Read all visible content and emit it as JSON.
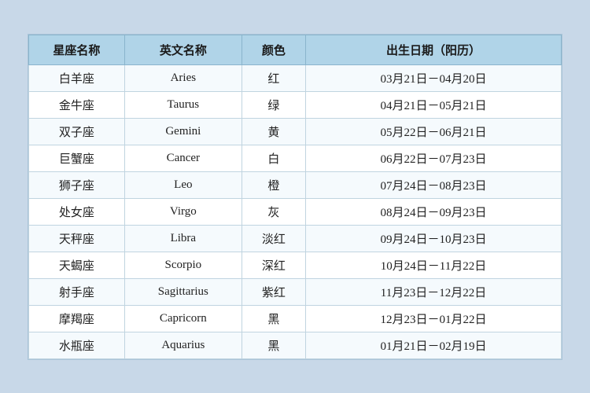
{
  "table": {
    "headers": [
      "星座名称",
      "英文名称",
      "颜色",
      "出生日期（阳历）"
    ],
    "rows": [
      {
        "name": "白羊座",
        "en": "Aries",
        "color": "红",
        "date": "03月21日－04月20日"
      },
      {
        "name": "金牛座",
        "en": "Taurus",
        "color": "绿",
        "date": "04月21日－05月21日"
      },
      {
        "name": "双子座",
        "en": "Gemini",
        "color": "黄",
        "date": "05月22日－06月21日"
      },
      {
        "name": "巨蟹座",
        "en": "Cancer",
        "color": "白",
        "date": "06月22日－07月23日"
      },
      {
        "name": "狮子座",
        "en": "Leo",
        "color": "橙",
        "date": "07月24日－08月23日"
      },
      {
        "name": "处女座",
        "en": "Virgo",
        "color": "灰",
        "date": "08月24日－09月23日"
      },
      {
        "name": "天秤座",
        "en": "Libra",
        "color": "淡红",
        "date": "09月24日－10月23日"
      },
      {
        "name": "天蝎座",
        "en": "Scorpio",
        "color": "深红",
        "date": "10月24日－11月22日"
      },
      {
        "name": "射手座",
        "en": "Sagittarius",
        "color": "紫红",
        "date": "11月23日－12月22日"
      },
      {
        "name": "摩羯座",
        "en": "Capricorn",
        "color": "黑",
        "date": "12月23日－01月22日"
      },
      {
        "name": "水瓶座",
        "en": "Aquarius",
        "color": "黑",
        "date": "01月21日－02月19日"
      }
    ]
  }
}
